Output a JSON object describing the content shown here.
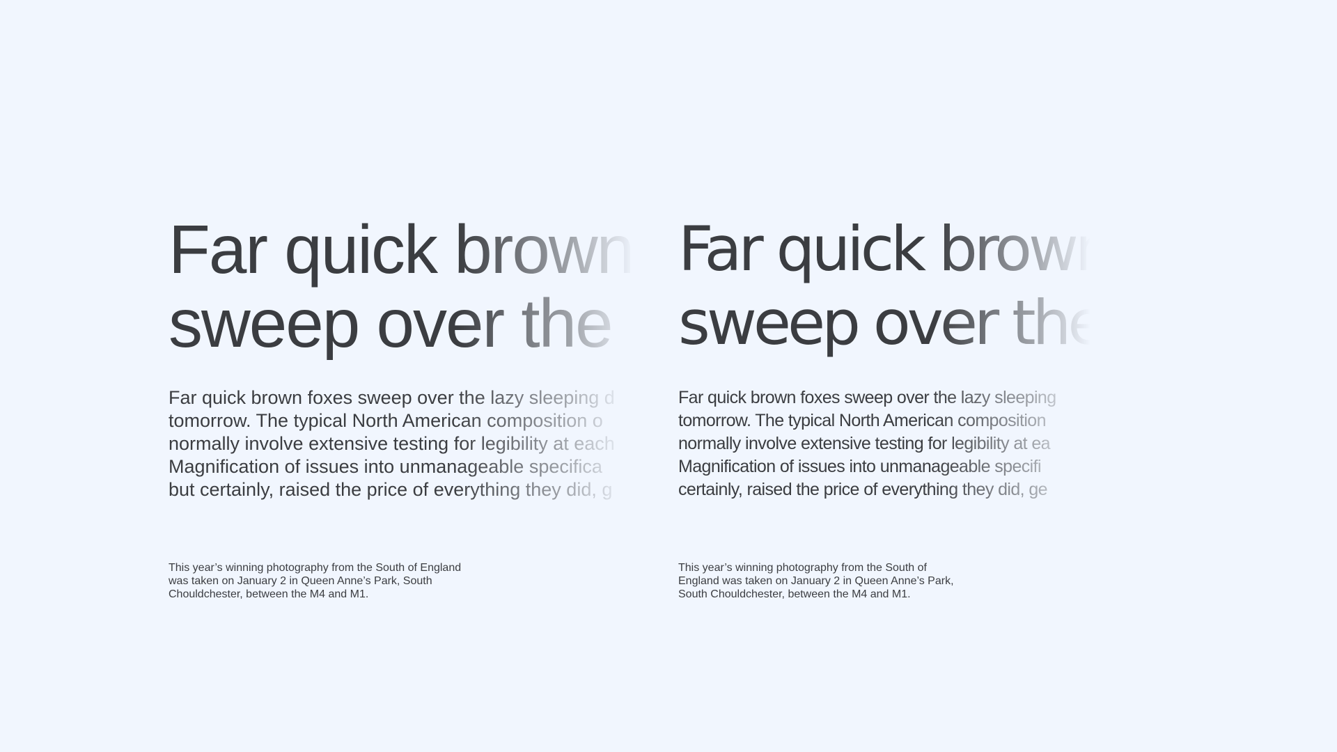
{
  "background": "#f1f6fe",
  "text_color": "#3b3d41",
  "specimens": [
    {
      "headline": [
        "Far quick brown",
        "sweep over the"
      ],
      "body": [
        "Far quick brown foxes sweep over the lazy sleeping d",
        "tomorrow. The typical North American composition o",
        "normally involve extensive testing for legibility at each",
        "Magnification of issues into unmanageable specifica",
        "but certainly, raised the price of everything they did, g"
      ],
      "caption": [
        "This year’s winning photography from the South of England",
        "was taken on January 2 in Queen Anne’s Park, South",
        "Chouldchester, between the M4 and M1."
      ]
    },
    {
      "headline": [
        "Far quick brown",
        "sweep over the"
      ],
      "body": [
        "Far quick brown foxes sweep over the lazy sleeping",
        "tomorrow. The typical North American composition",
        "normally involve extensive testing for legibility at ea",
        "Magnification of issues into unmanageable specifi",
        "certainly, raised the price of everything they did, ge"
      ],
      "caption": [
        "This year’s winning photography from the South of",
        "England was taken on January 2 in Queen Anne’s Park,",
        "South Chouldchester, between the M4 and M1."
      ]
    }
  ]
}
